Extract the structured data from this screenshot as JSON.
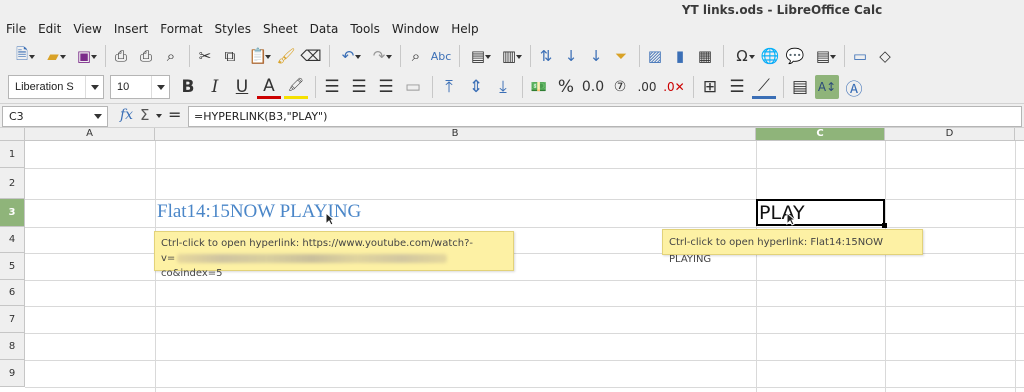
{
  "window": {
    "title": "YT links.ods - LibreOffice Calc"
  },
  "menu": [
    "File",
    "Edit",
    "View",
    "Insert",
    "Format",
    "Styles",
    "Sheet",
    "Data",
    "Tools",
    "Window",
    "Help"
  ],
  "toolbar_format": {
    "font_name": "Liberation S",
    "font_size": "10"
  },
  "formula_bar": {
    "cell_ref": "C3",
    "formula": "=HYPERLINK(B3,\"PLAY\")"
  },
  "columns": [
    "A",
    "B",
    "C",
    "D"
  ],
  "selected_column": "C",
  "rows": [
    "1",
    "2",
    "3",
    "4",
    "5",
    "6",
    "7",
    "8",
    "9"
  ],
  "selected_row": "3",
  "cells": {
    "B3": "Flat14:15NOW PLAYING",
    "C3": "PLAY"
  },
  "tooltips": {
    "b3_line1": "Ctrl-click to open hyperlink: https://www.youtube.com/watch?-",
    "b3_line2_prefix": "v=",
    "b3_line2_suffix": "co&index=5",
    "c3": "Ctrl-click to open hyperlink: Flat14:15NOW PLAYING"
  },
  "colors": {
    "selection_header": "#8fb47a",
    "hyperlink": "#4a86c8",
    "tooltip_bg": "#fdf1a4"
  }
}
